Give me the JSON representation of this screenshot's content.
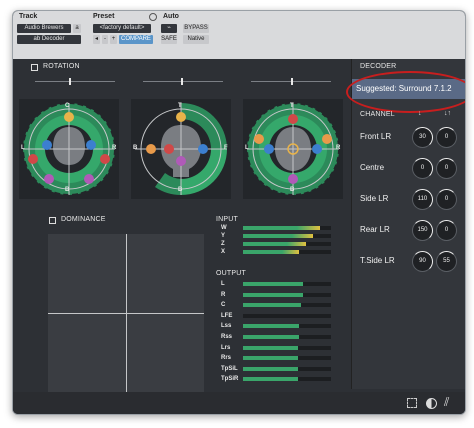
{
  "header": {
    "track_label": "Track",
    "preset_label": "Preset",
    "auto_label": "Auto",
    "track_name": "Audio Brewers",
    "track_suffix": "a",
    "insert_name": "ab Decoder",
    "preset_name": "<factory default>",
    "preset_minus": "-",
    "preset_plus": "+",
    "compare": "COMPARE",
    "safe": "SAFE",
    "bypass": "BYPASS",
    "native": "Native"
  },
  "rotation": {
    "title": "ROTATION"
  },
  "dominance": {
    "title": "DOMINANCE"
  },
  "spheres": [
    {
      "top": "C",
      "bottom": "B",
      "left": "L",
      "right": "R"
    },
    {
      "top": "T",
      "bottom": "B",
      "left": "B",
      "right": "F"
    },
    {
      "top": "T",
      "bottom": "B",
      "left": "L",
      "right": "R"
    }
  ],
  "input": {
    "title": "INPUT",
    "channels": [
      {
        "name": "W",
        "level": 0.88
      },
      {
        "name": "Y",
        "level": 0.8
      },
      {
        "name": "Z",
        "level": 0.72
      },
      {
        "name": "X",
        "level": 0.64
      }
    ]
  },
  "output": {
    "title": "OUTPUT",
    "channels": [
      {
        "name": "L",
        "level": 0.68
      },
      {
        "name": "R",
        "level": 0.68
      },
      {
        "name": "C",
        "level": 0.66
      },
      {
        "name": "LFE",
        "level": 0.0
      },
      {
        "name": "Lss",
        "level": 0.64
      },
      {
        "name": "Rss",
        "level": 0.64
      },
      {
        "name": "Lrs",
        "level": 0.62
      },
      {
        "name": "Rrs",
        "level": 0.62
      },
      {
        "name": "TpSiL",
        "level": 0.62
      },
      {
        "name": "TpSiR",
        "level": 0.62
      }
    ]
  },
  "decoder": {
    "title": "DECODER",
    "suggested": "Suggested: Surround 7.1.2",
    "channel_header": "CHANNEL",
    "channels": [
      {
        "name": "Front LR",
        "k1": "30",
        "k2": "0"
      },
      {
        "name": "Centre",
        "k1": "0",
        "k2": "0"
      },
      {
        "name": "Side LR",
        "k1": "110",
        "k2": "0"
      },
      {
        "name": "Rear LR",
        "k1": "150",
        "k2": "0"
      },
      {
        "name": "T.Side LR",
        "k1": "90",
        "k2": "55"
      }
    ]
  },
  "colors": {
    "accent_green": "#3aa56a",
    "accent_red": "#c81e1e",
    "knob_arc": "#f2f2f2",
    "header_bg": "#d9dadc"
  },
  "icons": [
    "fullscreen-icon",
    "contrast-icon",
    "audio-brewers-logo-icon"
  ]
}
